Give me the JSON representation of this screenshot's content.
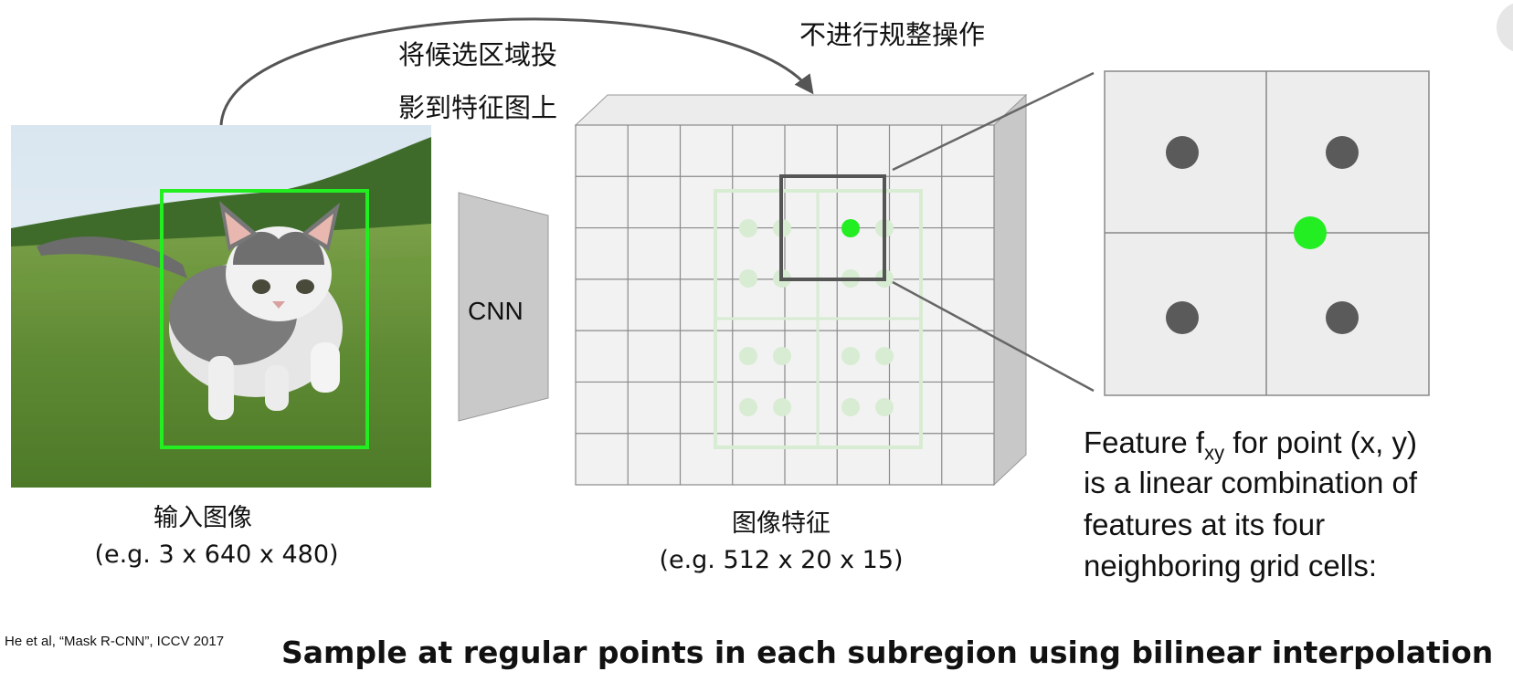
{
  "arrow_text": {
    "line1": "将候选区域投",
    "line2": "影到特征图上"
  },
  "no_quantize_text": "不进行规整操作",
  "cnn_label": "CNN",
  "input_image": {
    "title": "输入图像",
    "dims": "(e.g. 3 x 640 x 480)"
  },
  "feature_map": {
    "title": "图像特征",
    "dims": "(e.g. 512 x 20 x 15)"
  },
  "feature_desc": {
    "line1_prefix": "Feature f",
    "line1_sub": "xy",
    "line1_suffix": " for point (x, y)",
    "line2": "is a linear combination of",
    "line3": "features at its four",
    "line4": "neighboring grid cells:"
  },
  "citation": "He et al, “Mask R-CNN”, ICCV 2017",
  "footer": "Sample at regular points  in each subregion using  bilinear interpolation",
  "colors": {
    "green": "#22ee22",
    "pale_green": "#d7ecd2",
    "grid_face": "#f2f2f2",
    "grid_line": "#8a8a8a",
    "gray_dot": "#5a5a5a",
    "cnn_fill": "#c9c9c9"
  }
}
